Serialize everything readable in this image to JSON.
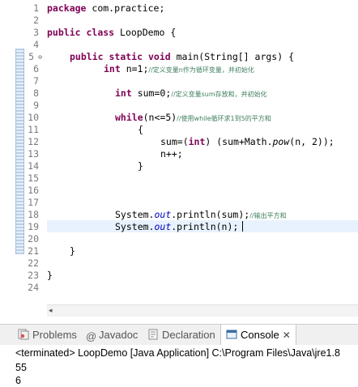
{
  "editor": {
    "line_numbers": [
      "1",
      "2",
      "3",
      "4",
      "5",
      "6",
      "7",
      "8",
      "9",
      "10",
      "11",
      "12",
      "13",
      "14",
      "15",
      "16",
      "17",
      "18",
      "19",
      "20",
      "21",
      "22",
      "23",
      "24"
    ],
    "code": {
      "l1": {
        "kw": "package",
        "rest": " com.practice;"
      },
      "l3": {
        "kw1": "public",
        "kw2": "class",
        "rest": " LoopDemo {"
      },
      "l5": {
        "kw1": "public",
        "kw2": "static",
        "kw3": "void",
        "rest": " main(String[] args) {"
      },
      "l6": {
        "kw": "int",
        "rest": " n=1;",
        "comment": "//定义变量n作为循环变量，并初始化"
      },
      "l8": {
        "kw": "int",
        "rest": " sum=0;",
        "comment": "//定义变量sum存放和，并初始化"
      },
      "l10": {
        "kw": "while",
        "rest": "(n<=5)",
        "comment": "//使用while循环求1到5的平方和"
      },
      "l11": "{",
      "l12": {
        "a": "sum=(",
        "kw": "int",
        "b": ") (sum+Math.",
        "method": "pow",
        "c": "(n, 2));"
      },
      "l13": "n++;",
      "l14": "}",
      "l18": {
        "a": "System.",
        "field": "out",
        "b": ".println(sum);",
        "comment": "//输出平方和"
      },
      "l19": {
        "a": "System.",
        "field": "out",
        "b": ".println(n);"
      },
      "l21": "}",
      "l23": "}"
    }
  },
  "views": {
    "tabs": [
      {
        "label": "Problems",
        "icon": "problems-icon"
      },
      {
        "label": "Javadoc",
        "icon": "javadoc-icon"
      },
      {
        "label": "Declaration",
        "icon": "declaration-icon"
      },
      {
        "label": "Console",
        "icon": "console-icon",
        "active": true
      }
    ],
    "close_glyph": "✕"
  },
  "console": {
    "terminated": "<terminated> LoopDemo [Java Application] C:\\Program Files\\Java\\jre1.8",
    "output": [
      "55",
      "6"
    ]
  },
  "colors": {
    "keyword": "#7f0055",
    "comment": "#3f7f5f",
    "field": "#0000c0",
    "current_line": "#e8f2fe"
  }
}
